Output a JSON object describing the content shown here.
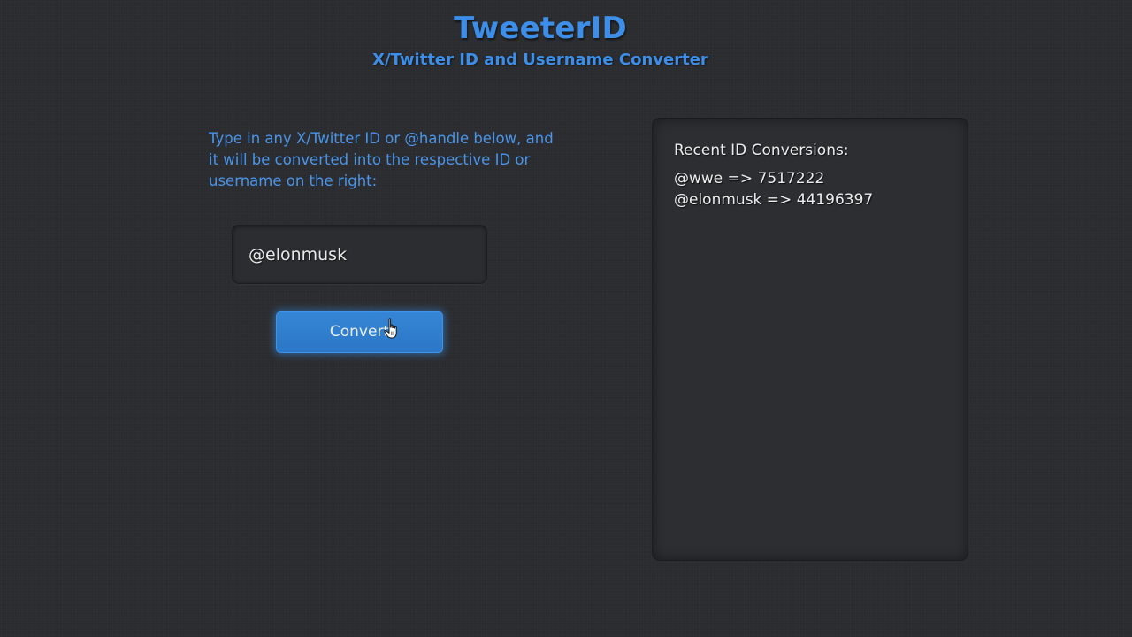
{
  "header": {
    "title": "TweeterID",
    "subtitle": "X/Twitter ID and Username Converter"
  },
  "form": {
    "instructions": "Type in any X/Twitter ID or @handle below, and it will be converted into the respective ID or username on the right:",
    "input_value": "@elonmusk",
    "convert_label": "Convert"
  },
  "recent": {
    "heading": "Recent ID Conversions:",
    "items": [
      "@wwe => 7517222",
      "@elonmusk => 44196397"
    ]
  },
  "colors": {
    "accent": "#3d8ee8",
    "button": "#2f7cca",
    "background": "#2b2c2f"
  },
  "icons": {
    "cursor": "hand-pointer-icon"
  }
}
